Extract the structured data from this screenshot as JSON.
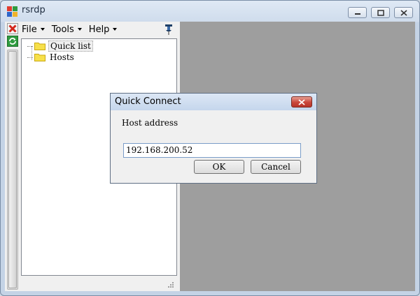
{
  "window": {
    "title": "rsrdp"
  },
  "menu": {
    "items": [
      {
        "label": "File"
      },
      {
        "label": "Tools"
      },
      {
        "label": "Help"
      }
    ]
  },
  "tree": {
    "items": [
      {
        "label": "Quick list"
      },
      {
        "label": "Hosts"
      }
    ]
  },
  "dialog": {
    "title": "Quick Connect",
    "label": "Host address",
    "host_value": "192.168.200.52",
    "ok_label": "OK",
    "cancel_label": "Cancel"
  },
  "icons": {
    "app": "app-icon",
    "disconnect": "red-x-icon",
    "refresh": "green-refresh-icon",
    "pin": "pin-icon",
    "folder": "folder-icon"
  },
  "colors": {
    "viewport_bg": "#9e9e9e",
    "close_red": "#c9463a"
  }
}
